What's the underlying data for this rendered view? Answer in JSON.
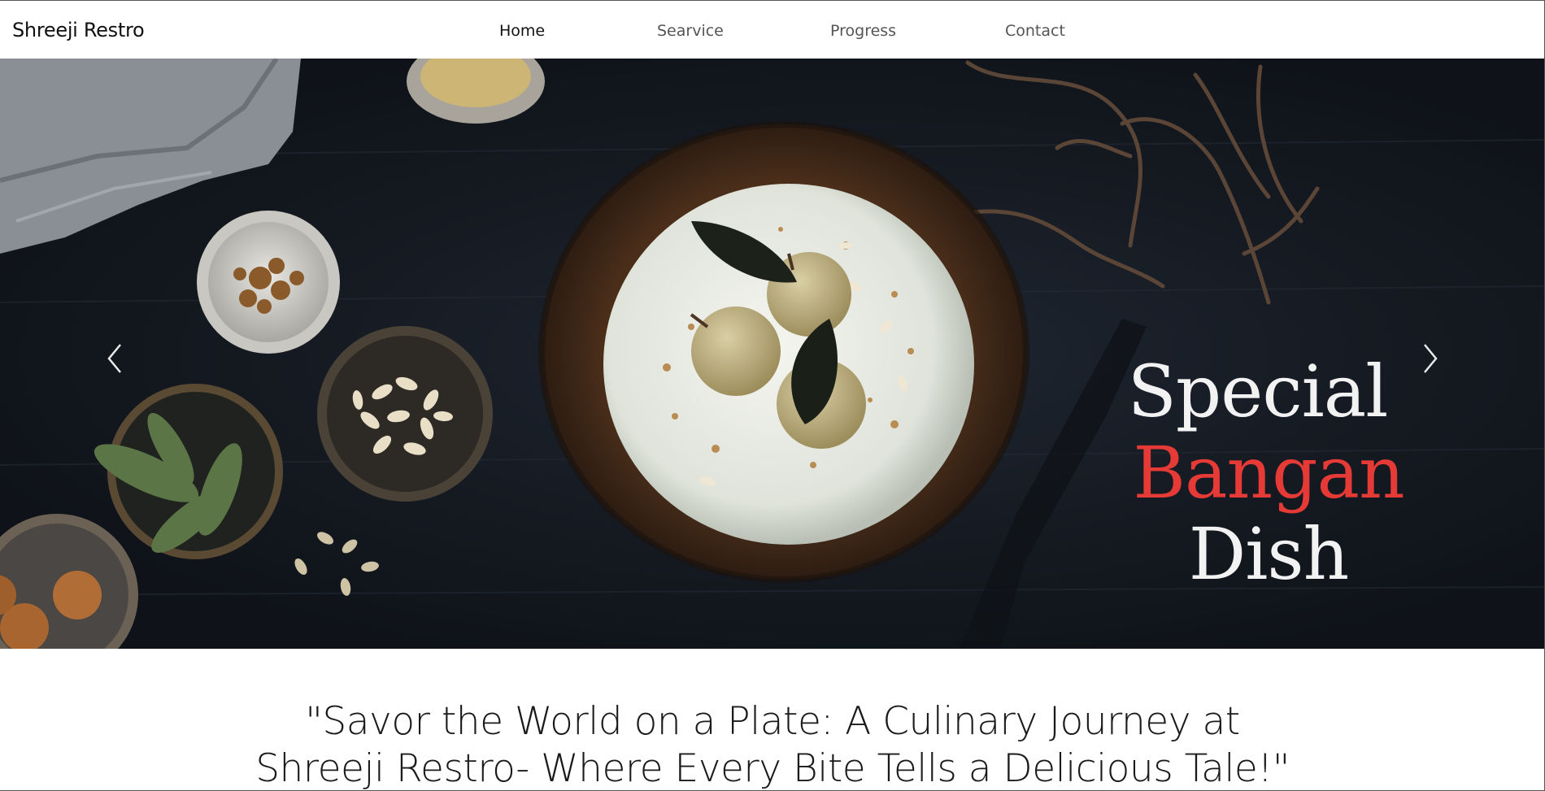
{
  "navbar": {
    "brand": "Shreeji Restro",
    "items": [
      {
        "label": "Home",
        "active": true
      },
      {
        "label": "Searvice",
        "active": false
      },
      {
        "label": "Progress",
        "active": false
      },
      {
        "label": "Contact",
        "active": false
      }
    ]
  },
  "hero": {
    "caption_word1": "Special",
    "caption_word2": "Bangan",
    "caption_word3": "Dish",
    "prev_icon": "chevron-left-icon",
    "next_icon": "chevron-right-icon",
    "accent_color": "#e63a37"
  },
  "quote": {
    "line1": "\"Savor the World on a Plate: A Culinary Journey at",
    "line2": "Shreeji Restro- Where Every Bite Tells a Delicious Tale!\""
  }
}
